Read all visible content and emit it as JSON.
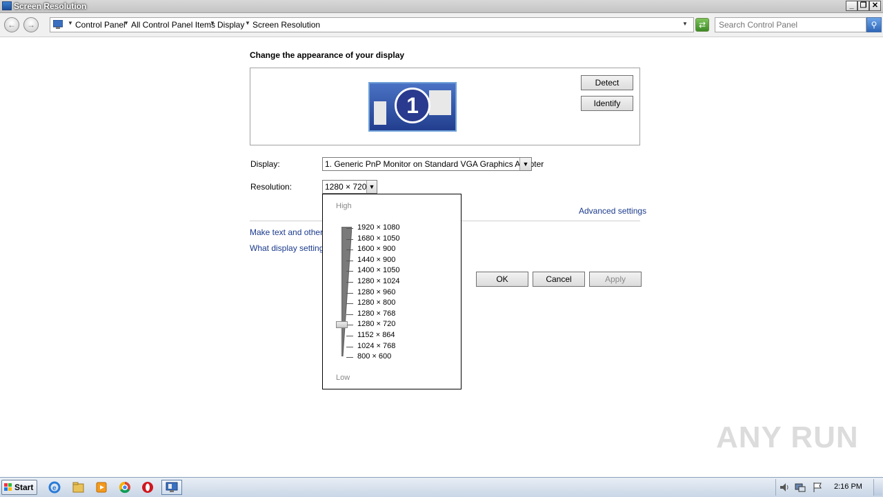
{
  "window": {
    "title": "Screen Resolution",
    "controls": {
      "minimize": "_",
      "maximize": "❐",
      "close": "✕"
    }
  },
  "nav": {
    "back": "←",
    "forward": "→"
  },
  "breadcrumb": [
    "Control Panel",
    "All Control Panel Items",
    "Display",
    "Screen Resolution"
  ],
  "search": {
    "placeholder": "Search Control Panel"
  },
  "main": {
    "heading": "Change the appearance of your display",
    "monitor_number": "1",
    "detect_label": "Detect",
    "identify_label": "Identify",
    "display_label": "Display:",
    "display_value": "1. Generic PnP Monitor on Standard VGA Graphics Adapter",
    "resolution_label": "Resolution:",
    "resolution_value": "1280 × 720",
    "advanced_link": "Advanced settings",
    "make_text_link": "Make text and other it",
    "what_settings_link": "What display settings",
    "ok_label": "OK",
    "cancel_label": "Cancel",
    "apply_label": "Apply"
  },
  "resolution_dropdown": {
    "high_label": "High",
    "low_label": "Low",
    "options": [
      "1920 × 1080",
      "1680 × 1050",
      "1600 × 900",
      "1440 × 900",
      "1400 × 1050",
      "1280 × 1024",
      "1280 × 960",
      "1280 × 800",
      "1280 × 768",
      "1280 × 720",
      "1152 × 864",
      "1024 × 768",
      "800 × 600"
    ],
    "selected_index": 9
  },
  "watermark": "ANY RUN",
  "taskbar": {
    "start_label": "Start",
    "icons": [
      "internet-explorer-icon",
      "file-explorer-icon",
      "media-player-icon",
      "chrome-icon",
      "opera-icon",
      "display-settings-icon"
    ],
    "clock": "2:16 PM"
  },
  "colors": {
    "accent": "#1a3a8c",
    "titlebar": "#c4c4c4",
    "taskbar": "#c9d6e6"
  }
}
